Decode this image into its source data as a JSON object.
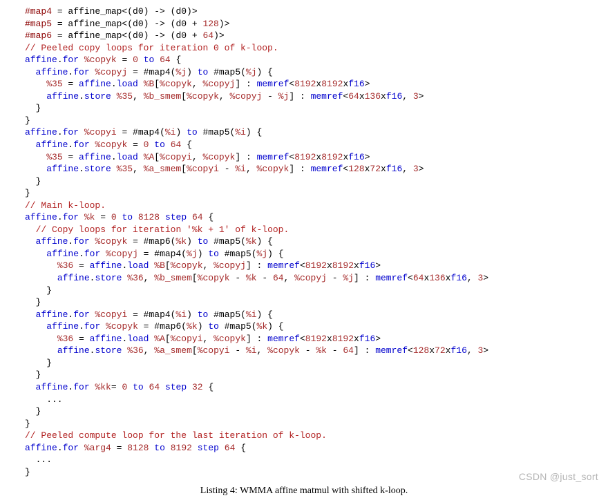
{
  "caption": "Listing 4: WMMA affine matmul with shifted k-loop.",
  "watermark": "CSDN @just_sort",
  "lines": [
    [
      [
        "dir",
        "#map4"
      ],
      [
        "p",
        " = affine_map<(d0) -> (d0)>"
      ]
    ],
    [
      [
        "dir",
        "#map5"
      ],
      [
        "p",
        " = affine_map<(d0) -> (d0 + "
      ],
      [
        "num",
        "128"
      ],
      [
        "p",
        ")>"
      ]
    ],
    [
      [
        "dir",
        "#map6"
      ],
      [
        "p",
        " = affine_map<(d0) -> (d0 + "
      ],
      [
        "num",
        "64"
      ],
      [
        "p",
        ")>"
      ]
    ],
    [
      [
        "cmt",
        "// Peeled copy loops for iteration 0 of k-loop."
      ]
    ],
    [
      [
        "kw",
        "affine"
      ],
      [
        "p",
        "."
      ],
      [
        "func",
        "for"
      ],
      [
        "p",
        " "
      ],
      [
        "var",
        "%copyk"
      ],
      [
        "p",
        " = "
      ],
      [
        "num",
        "0"
      ],
      [
        "p",
        " "
      ],
      [
        "kw",
        "to"
      ],
      [
        "p",
        " "
      ],
      [
        "num",
        "64"
      ],
      [
        "p",
        " {"
      ]
    ],
    [
      [
        "p",
        "  "
      ],
      [
        "kw",
        "affine"
      ],
      [
        "p",
        "."
      ],
      [
        "func",
        "for"
      ],
      [
        "p",
        " "
      ],
      [
        "var",
        "%copyj"
      ],
      [
        "p",
        " = #map4("
      ],
      [
        "var",
        "%j"
      ],
      [
        "p",
        ") "
      ],
      [
        "kw",
        "to"
      ],
      [
        "p",
        " #map5("
      ],
      [
        "var",
        "%j"
      ],
      [
        "p",
        ") {"
      ]
    ],
    [
      [
        "p",
        "    "
      ],
      [
        "var",
        "%35"
      ],
      [
        "p",
        " = "
      ],
      [
        "kw",
        "affine"
      ],
      [
        "p",
        "."
      ],
      [
        "func",
        "load"
      ],
      [
        "p",
        " "
      ],
      [
        "var",
        "%B"
      ],
      [
        "p",
        "["
      ],
      [
        "var",
        "%copyk"
      ],
      [
        "p",
        ", "
      ],
      [
        "var",
        "%copyj"
      ],
      [
        "p",
        "] : "
      ],
      [
        "type",
        "memref"
      ],
      [
        "p",
        "<"
      ],
      [
        "num",
        "8192"
      ],
      [
        "p",
        "x"
      ],
      [
        "num",
        "8192"
      ],
      [
        "p",
        "x"
      ],
      [
        "type",
        "f16"
      ],
      [
        "p",
        ">"
      ]
    ],
    [
      [
        "p",
        "    "
      ],
      [
        "kw",
        "affine"
      ],
      [
        "p",
        "."
      ],
      [
        "func",
        "store"
      ],
      [
        "p",
        " "
      ],
      [
        "var",
        "%35"
      ],
      [
        "p",
        ", "
      ],
      [
        "var",
        "%b_smem"
      ],
      [
        "p",
        "["
      ],
      [
        "var",
        "%copyk"
      ],
      [
        "p",
        ", "
      ],
      [
        "var",
        "%copyj"
      ],
      [
        "p",
        " - "
      ],
      [
        "var",
        "%j"
      ],
      [
        "p",
        "] : "
      ],
      [
        "type",
        "memref"
      ],
      [
        "p",
        "<"
      ],
      [
        "num",
        "64"
      ],
      [
        "p",
        "x"
      ],
      [
        "num",
        "136"
      ],
      [
        "p",
        "x"
      ],
      [
        "type",
        "f16"
      ],
      [
        "p",
        ", "
      ],
      [
        "num",
        "3"
      ],
      [
        "p",
        ">"
      ]
    ],
    [
      [
        "p",
        "  }"
      ]
    ],
    [
      [
        "p",
        "}"
      ]
    ],
    [
      [
        "kw",
        "affine"
      ],
      [
        "p",
        "."
      ],
      [
        "func",
        "for"
      ],
      [
        "p",
        " "
      ],
      [
        "var",
        "%copyi"
      ],
      [
        "p",
        " = #map4("
      ],
      [
        "var",
        "%i"
      ],
      [
        "p",
        ") "
      ],
      [
        "kw",
        "to"
      ],
      [
        "p",
        " #map5("
      ],
      [
        "var",
        "%i"
      ],
      [
        "p",
        ") {"
      ]
    ],
    [
      [
        "p",
        "  "
      ],
      [
        "kw",
        "affine"
      ],
      [
        "p",
        "."
      ],
      [
        "func",
        "for"
      ],
      [
        "p",
        " "
      ],
      [
        "var",
        "%copyk"
      ],
      [
        "p",
        " = "
      ],
      [
        "num",
        "0"
      ],
      [
        "p",
        " "
      ],
      [
        "kw",
        "to"
      ],
      [
        "p",
        " "
      ],
      [
        "num",
        "64"
      ],
      [
        "p",
        " {"
      ]
    ],
    [
      [
        "p",
        "    "
      ],
      [
        "var",
        "%35"
      ],
      [
        "p",
        " = "
      ],
      [
        "kw",
        "affine"
      ],
      [
        "p",
        "."
      ],
      [
        "func",
        "load"
      ],
      [
        "p",
        " "
      ],
      [
        "var",
        "%A"
      ],
      [
        "p",
        "["
      ],
      [
        "var",
        "%copyi"
      ],
      [
        "p",
        ", "
      ],
      [
        "var",
        "%copyk"
      ],
      [
        "p",
        "] : "
      ],
      [
        "type",
        "memref"
      ],
      [
        "p",
        "<"
      ],
      [
        "num",
        "8192"
      ],
      [
        "p",
        "x"
      ],
      [
        "num",
        "8192"
      ],
      [
        "p",
        "x"
      ],
      [
        "type",
        "f16"
      ],
      [
        "p",
        ">"
      ]
    ],
    [
      [
        "p",
        "    "
      ],
      [
        "kw",
        "affine"
      ],
      [
        "p",
        "."
      ],
      [
        "func",
        "store"
      ],
      [
        "p",
        " "
      ],
      [
        "var",
        "%35"
      ],
      [
        "p",
        ", "
      ],
      [
        "var",
        "%a_smem"
      ],
      [
        "p",
        "["
      ],
      [
        "var",
        "%copyi"
      ],
      [
        "p",
        " - "
      ],
      [
        "var",
        "%i"
      ],
      [
        "p",
        ", "
      ],
      [
        "var",
        "%copyk"
      ],
      [
        "p",
        "] : "
      ],
      [
        "type",
        "memref"
      ],
      [
        "p",
        "<"
      ],
      [
        "num",
        "128"
      ],
      [
        "p",
        "x"
      ],
      [
        "num",
        "72"
      ],
      [
        "p",
        "x"
      ],
      [
        "type",
        "f16"
      ],
      [
        "p",
        ", "
      ],
      [
        "num",
        "3"
      ],
      [
        "p",
        ">"
      ]
    ],
    [
      [
        "p",
        "  }"
      ]
    ],
    [
      [
        "p",
        "}"
      ]
    ],
    [
      [
        "cmt",
        "// Main k-loop."
      ]
    ],
    [
      [
        "kw",
        "affine"
      ],
      [
        "p",
        "."
      ],
      [
        "func",
        "for"
      ],
      [
        "p",
        " "
      ],
      [
        "var",
        "%k"
      ],
      [
        "p",
        " = "
      ],
      [
        "num",
        "0"
      ],
      [
        "p",
        " "
      ],
      [
        "kw",
        "to"
      ],
      [
        "p",
        " "
      ],
      [
        "num",
        "8128"
      ],
      [
        "p",
        " "
      ],
      [
        "kw",
        "step"
      ],
      [
        "p",
        " "
      ],
      [
        "num",
        "64"
      ],
      [
        "p",
        " {"
      ]
    ],
    [
      [
        "p",
        "  "
      ],
      [
        "cmt",
        "// Copy loops for iteration '%k + 1' of k-loop."
      ]
    ],
    [
      [
        "p",
        "  "
      ],
      [
        "kw",
        "affine"
      ],
      [
        "p",
        "."
      ],
      [
        "func",
        "for"
      ],
      [
        "p",
        " "
      ],
      [
        "var",
        "%copyk"
      ],
      [
        "p",
        " = #map6("
      ],
      [
        "var",
        "%k"
      ],
      [
        "p",
        ") "
      ],
      [
        "kw",
        "to"
      ],
      [
        "p",
        " #map5("
      ],
      [
        "var",
        "%k"
      ],
      [
        "p",
        ") {"
      ]
    ],
    [
      [
        "p",
        "    "
      ],
      [
        "kw",
        "affine"
      ],
      [
        "p",
        "."
      ],
      [
        "func",
        "for"
      ],
      [
        "p",
        " "
      ],
      [
        "var",
        "%copyj"
      ],
      [
        "p",
        " = #map4("
      ],
      [
        "var",
        "%j"
      ],
      [
        "p",
        ") "
      ],
      [
        "kw",
        "to"
      ],
      [
        "p",
        " #map5("
      ],
      [
        "var",
        "%j"
      ],
      [
        "p",
        ") {"
      ]
    ],
    [
      [
        "p",
        "      "
      ],
      [
        "var",
        "%36"
      ],
      [
        "p",
        " = "
      ],
      [
        "kw",
        "affine"
      ],
      [
        "p",
        "."
      ],
      [
        "func",
        "load"
      ],
      [
        "p",
        " "
      ],
      [
        "var",
        "%B"
      ],
      [
        "p",
        "["
      ],
      [
        "var",
        "%copyk"
      ],
      [
        "p",
        ", "
      ],
      [
        "var",
        "%copyj"
      ],
      [
        "p",
        "] : "
      ],
      [
        "type",
        "memref"
      ],
      [
        "p",
        "<"
      ],
      [
        "num",
        "8192"
      ],
      [
        "p",
        "x"
      ],
      [
        "num",
        "8192"
      ],
      [
        "p",
        "x"
      ],
      [
        "type",
        "f16"
      ],
      [
        "p",
        ">"
      ]
    ],
    [
      [
        "p",
        "      "
      ],
      [
        "kw",
        "affine"
      ],
      [
        "p",
        "."
      ],
      [
        "func",
        "store"
      ],
      [
        "p",
        " "
      ],
      [
        "var",
        "%36"
      ],
      [
        "p",
        ", "
      ],
      [
        "var",
        "%b_smem"
      ],
      [
        "p",
        "["
      ],
      [
        "var",
        "%copyk"
      ],
      [
        "p",
        " - "
      ],
      [
        "var",
        "%k"
      ],
      [
        "p",
        " - "
      ],
      [
        "num",
        "64"
      ],
      [
        "p",
        ", "
      ],
      [
        "var",
        "%copyj"
      ],
      [
        "p",
        " - "
      ],
      [
        "var",
        "%j"
      ],
      [
        "p",
        "] : "
      ],
      [
        "type",
        "memref"
      ],
      [
        "p",
        "<"
      ],
      [
        "num",
        "64"
      ],
      [
        "p",
        "x"
      ],
      [
        "num",
        "136"
      ],
      [
        "p",
        "x"
      ],
      [
        "type",
        "f16"
      ],
      [
        "p",
        ", "
      ],
      [
        "num",
        "3"
      ],
      [
        "p",
        ">"
      ]
    ],
    [
      [
        "p",
        "    }"
      ]
    ],
    [
      [
        "p",
        "  }"
      ]
    ],
    [
      [
        "p",
        "  "
      ],
      [
        "kw",
        "affine"
      ],
      [
        "p",
        "."
      ],
      [
        "func",
        "for"
      ],
      [
        "p",
        " "
      ],
      [
        "var",
        "%copyi"
      ],
      [
        "p",
        " = #map4("
      ],
      [
        "var",
        "%i"
      ],
      [
        "p",
        ") "
      ],
      [
        "kw",
        "to"
      ],
      [
        "p",
        " #map5("
      ],
      [
        "var",
        "%i"
      ],
      [
        "p",
        ") {"
      ]
    ],
    [
      [
        "p",
        "    "
      ],
      [
        "kw",
        "affine"
      ],
      [
        "p",
        "."
      ],
      [
        "func",
        "for"
      ],
      [
        "p",
        " "
      ],
      [
        "var",
        "%copyk"
      ],
      [
        "p",
        " = #map6("
      ],
      [
        "var",
        "%k"
      ],
      [
        "p",
        ") "
      ],
      [
        "kw",
        "to"
      ],
      [
        "p",
        " #map5("
      ],
      [
        "var",
        "%k"
      ],
      [
        "p",
        ") {"
      ]
    ],
    [
      [
        "p",
        "      "
      ],
      [
        "var",
        "%36"
      ],
      [
        "p",
        " = "
      ],
      [
        "kw",
        "affine"
      ],
      [
        "p",
        "."
      ],
      [
        "func",
        "load"
      ],
      [
        "p",
        " "
      ],
      [
        "var",
        "%A"
      ],
      [
        "p",
        "["
      ],
      [
        "var",
        "%copyi"
      ],
      [
        "p",
        ", "
      ],
      [
        "var",
        "%copyk"
      ],
      [
        "p",
        "] : "
      ],
      [
        "type",
        "memref"
      ],
      [
        "p",
        "<"
      ],
      [
        "num",
        "8192"
      ],
      [
        "p",
        "x"
      ],
      [
        "num",
        "8192"
      ],
      [
        "p",
        "x"
      ],
      [
        "type",
        "f16"
      ],
      [
        "p",
        ">"
      ]
    ],
    [
      [
        "p",
        "      "
      ],
      [
        "kw",
        "affine"
      ],
      [
        "p",
        "."
      ],
      [
        "func",
        "store"
      ],
      [
        "p",
        " "
      ],
      [
        "var",
        "%36"
      ],
      [
        "p",
        ", "
      ],
      [
        "var",
        "%a_smem"
      ],
      [
        "p",
        "["
      ],
      [
        "var",
        "%copyi"
      ],
      [
        "p",
        " - "
      ],
      [
        "var",
        "%i"
      ],
      [
        "p",
        ", "
      ],
      [
        "var",
        "%copyk"
      ],
      [
        "p",
        " - "
      ],
      [
        "var",
        "%k"
      ],
      [
        "p",
        " - "
      ],
      [
        "num",
        "64"
      ],
      [
        "p",
        "] : "
      ],
      [
        "type",
        "memref"
      ],
      [
        "p",
        "<"
      ],
      [
        "num",
        "128"
      ],
      [
        "p",
        "x"
      ],
      [
        "num",
        "72"
      ],
      [
        "p",
        "x"
      ],
      [
        "type",
        "f16"
      ],
      [
        "p",
        ", "
      ],
      [
        "num",
        "3"
      ],
      [
        "p",
        ">"
      ]
    ],
    [
      [
        "p",
        "    }"
      ]
    ],
    [
      [
        "p",
        "  }"
      ]
    ],
    [
      [
        "p",
        "  "
      ],
      [
        "kw",
        "affine"
      ],
      [
        "p",
        "."
      ],
      [
        "func",
        "for"
      ],
      [
        "p",
        " "
      ],
      [
        "var",
        "%kk"
      ],
      [
        "p",
        "= "
      ],
      [
        "num",
        "0"
      ],
      [
        "p",
        " "
      ],
      [
        "kw",
        "to"
      ],
      [
        "p",
        " "
      ],
      [
        "num",
        "64"
      ],
      [
        "p",
        " "
      ],
      [
        "kw",
        "step"
      ],
      [
        "p",
        " "
      ],
      [
        "num",
        "32"
      ],
      [
        "p",
        " {"
      ]
    ],
    [
      [
        "p",
        "    ..."
      ]
    ],
    [
      [
        "p",
        "  }"
      ]
    ],
    [
      [
        "p",
        "}"
      ]
    ],
    [
      [
        "cmt",
        "// Peeled compute loop for the last iteration of k-loop."
      ]
    ],
    [
      [
        "kw",
        "affine"
      ],
      [
        "p",
        "."
      ],
      [
        "func",
        "for"
      ],
      [
        "p",
        " "
      ],
      [
        "var",
        "%arg4"
      ],
      [
        "p",
        " = "
      ],
      [
        "num",
        "8128"
      ],
      [
        "p",
        " "
      ],
      [
        "kw",
        "to"
      ],
      [
        "p",
        " "
      ],
      [
        "num",
        "8192"
      ],
      [
        "p",
        " "
      ],
      [
        "kw",
        "step"
      ],
      [
        "p",
        " "
      ],
      [
        "num",
        "64"
      ],
      [
        "p",
        " {"
      ]
    ],
    [
      [
        "p",
        "  ..."
      ]
    ],
    [
      [
        "p",
        "}"
      ]
    ]
  ]
}
